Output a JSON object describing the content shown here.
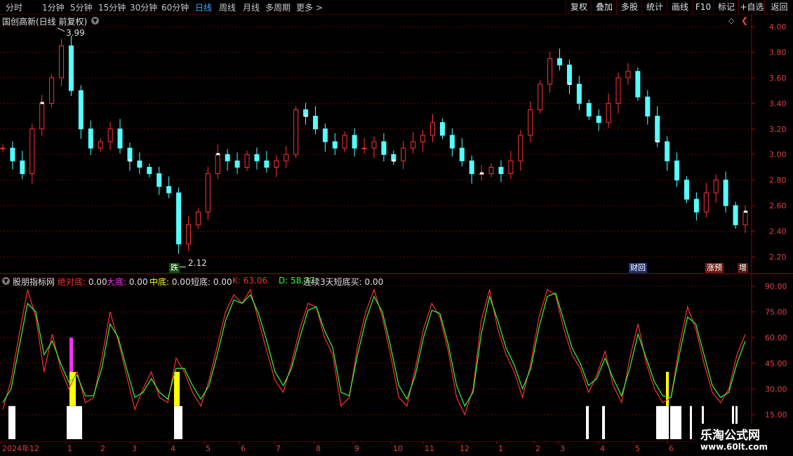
{
  "toolbar": {
    "periods": [
      "分时",
      "1分钟",
      "5分钟",
      "15分钟",
      "30分钟",
      "60分钟",
      "日线",
      "周线",
      "月线",
      "多周期",
      "更多"
    ],
    "active": "日线",
    "right": [
      "复权",
      "叠加",
      "多股",
      "统计",
      "画线",
      "F10",
      "标记",
      "+自选",
      "返回"
    ]
  },
  "main": {
    "title": "国创高新(日线 前复权)",
    "high_label": "3.99",
    "low_label": "2.12",
    "price_axis": [
      "4.00",
      "3.80",
      "3.60",
      "3.40",
      "3.20",
      "3.00",
      "2.80",
      "2.60",
      "2.40",
      "2.20"
    ],
    "tags": {
      "die": "跌",
      "cai": "财回",
      "zhangyu": "涨预",
      "zeng": "增"
    }
  },
  "indicator": {
    "name": "股朋指标网",
    "items": [
      {
        "label": "绝对底:",
        "value": "0.00",
        "color": "#ff3030"
      },
      {
        "label": "大底:",
        "value": "0.00",
        "color": "#ff30ff"
      },
      {
        "label": "中底:",
        "value": "0.00",
        "color": "#ffff00"
      },
      {
        "label": "短底:",
        "value": "0.00",
        "color": "#e0e0e0"
      },
      {
        "label": "K:",
        "value": "63.06",
        "color": "#ff3030"
      },
      {
        "label": "D:",
        "value": "58.77",
        "color": "#30ff30"
      },
      {
        "label": "连续3天短底买:",
        "value": "0.00",
        "color": "#e0e0e0"
      }
    ],
    "axis": [
      "90.00",
      "75.00",
      "60.00",
      "45.00",
      "30.00",
      "15.00"
    ]
  },
  "date_axis": [
    "2024年12",
    "1",
    "2",
    "3",
    "4",
    "5",
    "6",
    "7",
    "8",
    "9",
    "10",
    "11",
    "12",
    "1",
    "2",
    "3",
    "4",
    "5",
    "6"
  ],
  "watermark": {
    "line1": "乐淘公式网",
    "line2": "www.60lt.com"
  },
  "colors": {
    "up": "#ff3333",
    "down": "#54ffff",
    "k_line": "#ff3030",
    "d_line": "#30ff30",
    "grid": "#6a0000"
  },
  "chart_data": [
    {
      "type": "candlestick",
      "title": "国创高新(日线 前复权)",
      "ylim": [
        2.1,
        4.05
      ],
      "y_ticks": [
        4.0,
        3.8,
        3.6,
        3.4,
        3.2,
        3.0,
        2.8,
        2.6,
        2.4,
        2.2
      ],
      "max": 3.99,
      "min": 2.12,
      "approx_close_series": [
        3.05,
        2.95,
        2.85,
        3.2,
        3.4,
        3.6,
        3.85,
        3.5,
        3.2,
        3.05,
        3.1,
        3.2,
        3.05,
        2.95,
        2.9,
        2.85,
        2.75,
        2.7,
        2.3,
        2.45,
        2.55,
        2.85,
        3.0,
        2.95,
        2.9,
        3.0,
        2.95,
        2.9,
        2.95,
        3.0,
        3.35,
        3.3,
        3.2,
        3.1,
        3.05,
        3.15,
        3.05,
        3.05,
        3.1,
        3.0,
        2.95,
        3.05,
        3.1,
        3.15,
        3.25,
        3.15,
        3.05,
        2.95,
        2.85,
        2.85,
        2.9,
        2.85,
        2.95,
        3.15,
        3.35,
        3.55,
        3.75,
        3.7,
        3.55,
        3.4,
        3.3,
        3.25,
        3.4,
        3.6,
        3.65,
        3.45,
        3.3,
        3.1,
        2.95,
        2.8,
        2.65,
        2.55,
        2.7,
        2.8,
        2.6,
        2.45,
        2.55
      ]
    },
    {
      "type": "line",
      "title": "股朋指标网",
      "ylim": [
        8,
        93
      ],
      "series": [
        {
          "name": "K",
          "values": [
            18,
            35,
            62,
            88,
            72,
            40,
            62,
            42,
            30,
            40,
            22,
            25,
            48,
            75,
            58,
            38,
            18,
            30,
            40,
            25,
            22,
            48,
            40,
            28,
            20,
            35,
            55,
            75,
            85,
            80,
            88,
            70,
            52,
            35,
            28,
            45,
            65,
            80,
            78,
            60,
            50,
            20,
            25,
            55,
            75,
            88,
            72,
            50,
            25,
            20,
            42,
            65,
            80,
            72,
            52,
            25,
            15,
            30,
            70,
            88,
            65,
            50,
            40,
            25,
            45,
            72,
            88,
            85,
            65,
            50,
            42,
            28,
            38,
            52,
            32,
            22,
            48,
            68,
            45,
            30,
            22,
            25,
            55,
            78,
            65,
            45,
            28,
            22,
            30,
            50,
            62
          ]
        },
        {
          "name": "D",
          "values": [
            22,
            30,
            55,
            80,
            75,
            50,
            58,
            45,
            34,
            38,
            26,
            26,
            42,
            68,
            60,
            42,
            25,
            28,
            36,
            28,
            24,
            42,
            42,
            32,
            24,
            32,
            50,
            70,
            82,
            80,
            85,
            74,
            58,
            40,
            32,
            42,
            60,
            76,
            78,
            64,
            54,
            28,
            26,
            50,
            70,
            84,
            75,
            55,
            32,
            24,
            38,
            60,
            76,
            74,
            56,
            32,
            20,
            28,
            62,
            84,
            70,
            54,
            44,
            30,
            42,
            66,
            84,
            86,
            70,
            54,
            45,
            32,
            36,
            48,
            36,
            26,
            42,
            62,
            48,
            34,
            26,
            25,
            50,
            72,
            68,
            50,
            32,
            25,
            28,
            45,
            58
          ]
        }
      ]
    }
  ]
}
